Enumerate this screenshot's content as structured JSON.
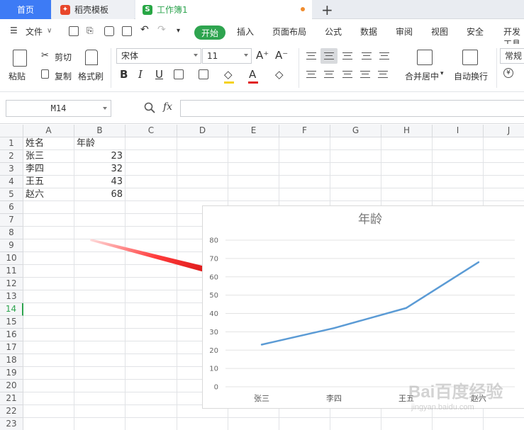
{
  "tabs": {
    "home": "首页",
    "template": "稻壳模板",
    "workbook": "工作簿1",
    "add": "+"
  },
  "menu": {
    "file": "文件",
    "start": "开始",
    "items": [
      "插入",
      "页面布局",
      "公式",
      "数据",
      "审阅",
      "视图",
      "安全",
      "开发工具"
    ]
  },
  "ribbon": {
    "paste": "粘贴",
    "cut": "剪切",
    "copy": "复制",
    "format_painter": "格式刷",
    "font_name": "宋体",
    "font_size": "11",
    "merge_center": "合并居中",
    "wrap_text": "自动换行",
    "number_format": "常规",
    "currency": "¥"
  },
  "formula_bar": {
    "name_box": "M14",
    "fx": "fx",
    "formula": ""
  },
  "sheet": {
    "columns": [
      "A",
      "B",
      "C",
      "D",
      "E",
      "F",
      "G",
      "H",
      "I",
      "J"
    ],
    "rows": [
      "1",
      "2",
      "3",
      "4",
      "5",
      "6",
      "7",
      "8",
      "9",
      "10",
      "11",
      "12",
      "13",
      "14",
      "15",
      "16",
      "17",
      "18",
      "19",
      "20",
      "21",
      "22",
      "23"
    ],
    "selected_row": "14",
    "cells": {
      "A1": "姓名",
      "B1": "年龄",
      "A2": "张三",
      "B2": "23",
      "A3": "李四",
      "B3": "32",
      "A4": "王五",
      "B4": "43",
      "A5": "赵六",
      "B5": "68"
    }
  },
  "chart_data": {
    "type": "line",
    "title": "年龄",
    "categories": [
      "张三",
      "李四",
      "王五",
      "赵六"
    ],
    "series": [
      {
        "values": [
          23,
          32,
          43,
          68
        ]
      }
    ],
    "y_ticks": [
      "0",
      "10",
      "20",
      "30",
      "40",
      "50",
      "60",
      "70",
      "80"
    ],
    "ylim": [
      0,
      80
    ],
    "grid": true,
    "legend": "none",
    "line_color": "#5b9bd5"
  },
  "annotation": {
    "arrow_color": "#e02020"
  },
  "watermark": {
    "text": "Bai百度经验",
    "url": "jingyan.baidu.com"
  },
  "colors": {
    "accent_green": "#2ea44f",
    "tab_blue": "#3d7bf5"
  }
}
